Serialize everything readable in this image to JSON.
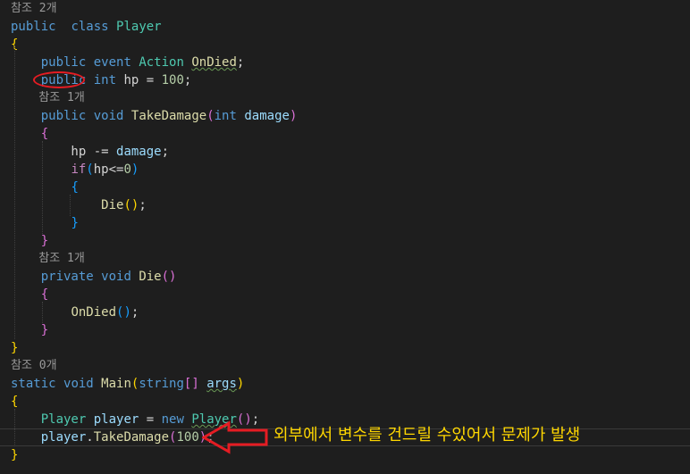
{
  "editor": {
    "lines": [
      {
        "kind": "codelens",
        "text": "참조 2개"
      },
      {
        "kind": "code",
        "tokens": [
          [
            "kw",
            "public"
          ],
          [
            "",
            "  "
          ],
          [
            "kw",
            "class"
          ],
          [
            "",
            " "
          ],
          [
            "ty",
            "Player"
          ]
        ]
      },
      {
        "kind": "code",
        "tokens": [
          [
            "b1",
            "{"
          ]
        ]
      },
      {
        "kind": "code",
        "tokens": [
          [
            "",
            "    "
          ],
          [
            "kw",
            "public"
          ],
          [
            "",
            " "
          ],
          [
            "kw",
            "event"
          ],
          [
            "",
            " "
          ],
          [
            "ty",
            "Action"
          ],
          [
            "",
            " "
          ],
          [
            "fn squig",
            "OnDied"
          ],
          [
            "",
            ";"
          ]
        ]
      },
      {
        "kind": "code",
        "tokens": [
          [
            "",
            "    "
          ],
          [
            "kw",
            "public"
          ],
          [
            "",
            " "
          ],
          [
            "kw",
            "int"
          ],
          [
            "",
            " hp = "
          ],
          [
            "nu",
            "100"
          ],
          [
            "",
            ";"
          ]
        ]
      },
      {
        "kind": "codelens",
        "text": "    참조 1개"
      },
      {
        "kind": "code",
        "tokens": [
          [
            "",
            "    "
          ],
          [
            "kw",
            "public"
          ],
          [
            "",
            " "
          ],
          [
            "kw",
            "void"
          ],
          [
            "",
            " "
          ],
          [
            "fn",
            "TakeDamage"
          ],
          [
            "b2",
            "("
          ],
          [
            "kw",
            "int"
          ],
          [
            "",
            " "
          ],
          [
            "pa",
            "damage"
          ],
          [
            "b2",
            ")"
          ]
        ]
      },
      {
        "kind": "code",
        "tokens": [
          [
            "",
            "    "
          ],
          [
            "b2",
            "{"
          ]
        ]
      },
      {
        "kind": "code",
        "tokens": [
          [
            "",
            "        hp -= "
          ],
          [
            "pa",
            "damage"
          ],
          [
            "",
            ";"
          ]
        ]
      },
      {
        "kind": "code",
        "tokens": [
          [
            "",
            "        "
          ],
          [
            "cc",
            "if"
          ],
          [
            "b3",
            "("
          ],
          [
            "",
            "hp<="
          ],
          [
            "nu",
            "0"
          ],
          [
            "b3",
            ")"
          ]
        ]
      },
      {
        "kind": "code",
        "tokens": [
          [
            "",
            "        "
          ],
          [
            "b3",
            "{"
          ]
        ]
      },
      {
        "kind": "code",
        "tokens": [
          [
            "",
            "            "
          ],
          [
            "fn",
            "Die"
          ],
          [
            "b1",
            "()"
          ],
          [
            "",
            ";"
          ]
        ]
      },
      {
        "kind": "code",
        "tokens": [
          [
            "",
            "        "
          ],
          [
            "b3",
            "}"
          ]
        ]
      },
      {
        "kind": "code",
        "tokens": [
          [
            "",
            "    "
          ],
          [
            "b2",
            "}"
          ]
        ]
      },
      {
        "kind": "codelens",
        "text": "    참조 1개"
      },
      {
        "kind": "code",
        "tokens": [
          [
            "",
            "    "
          ],
          [
            "kw",
            "private"
          ],
          [
            "",
            " "
          ],
          [
            "kw",
            "void"
          ],
          [
            "",
            " "
          ],
          [
            "fn",
            "Die"
          ],
          [
            "b2",
            "()"
          ]
        ]
      },
      {
        "kind": "code",
        "tokens": [
          [
            "",
            "    "
          ],
          [
            "b2",
            "{"
          ]
        ]
      },
      {
        "kind": "code",
        "tokens": [
          [
            "",
            "        "
          ],
          [
            "fn",
            "OnDied"
          ],
          [
            "b3",
            "()"
          ],
          [
            "",
            ";"
          ]
        ]
      },
      {
        "kind": "code",
        "tokens": [
          [
            "",
            "    "
          ],
          [
            "b2",
            "}"
          ]
        ]
      },
      {
        "kind": "code",
        "tokens": [
          [
            "b1",
            "}"
          ]
        ]
      },
      {
        "kind": "codelens",
        "text": "참조 0개"
      },
      {
        "kind": "code",
        "tokens": [
          [
            "kw",
            "static"
          ],
          [
            "",
            " "
          ],
          [
            "kw",
            "void"
          ],
          [
            "",
            " "
          ],
          [
            "fn",
            "Main"
          ],
          [
            "b1",
            "("
          ],
          [
            "kw",
            "string"
          ],
          [
            "b2",
            "[]"
          ],
          [
            "",
            " "
          ],
          [
            "pa squig",
            "args"
          ],
          [
            "b1",
            ")"
          ]
        ]
      },
      {
        "kind": "code",
        "tokens": [
          [
            "b1",
            "{"
          ]
        ]
      },
      {
        "kind": "code",
        "tokens": [
          [
            "",
            "    "
          ],
          [
            "ty",
            "Player"
          ],
          [
            "",
            " "
          ],
          [
            "pa",
            "player"
          ],
          [
            "",
            " = "
          ],
          [
            "kw",
            "new"
          ],
          [
            "",
            " "
          ],
          [
            "ty squig",
            "Player"
          ],
          [
            "b2",
            "()"
          ],
          [
            "",
            ";"
          ]
        ]
      },
      {
        "kind": "code",
        "current": true,
        "tokens": [
          [
            "",
            "    "
          ],
          [
            "pa",
            "player"
          ],
          [
            "",
            "."
          ],
          [
            "fn",
            "TakeDamage"
          ],
          [
            "b2",
            "("
          ],
          [
            "nu",
            "100"
          ],
          [
            "b2",
            ")"
          ],
          [
            "",
            ";"
          ]
        ]
      },
      {
        "kind": "code",
        "tokens": [
          [
            "b1",
            "}"
          ]
        ]
      }
    ]
  },
  "annotation": {
    "text": "외부에서 변수를 건드릴 수있어서 문제가 발생",
    "circle_target": "public",
    "color": "#e51c23",
    "text_color": "#ffd700"
  }
}
